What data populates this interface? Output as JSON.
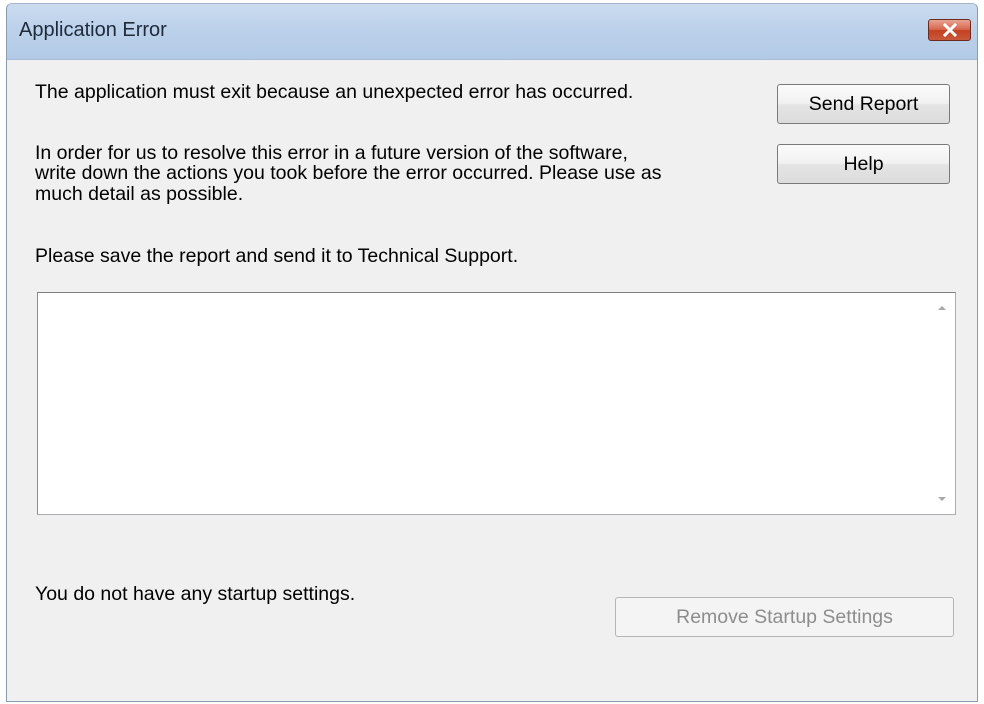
{
  "window": {
    "title": "Application Error",
    "close_icon": "close-x-icon",
    "close_color": "#c7432a"
  },
  "messages": {
    "exit_notice": "The application must exit because an unexpected error has occurred.",
    "resolve_line1": "In order for us to resolve this error in a future version of the software,",
    "resolve_line2": "write down the actions you took before the error occurred. Please use as",
    "resolve_line3": "much detail as possible.",
    "save_report": "Please save the report and send it to Technical Support.",
    "startup_status": "You do not have any startup settings."
  },
  "buttons": {
    "send_report": "Send Report",
    "help": "Help",
    "remove_startup": "Remove Startup Settings"
  },
  "report": {
    "value": "",
    "scroll_up_icon": "scroll-up-arrow-icon",
    "scroll_down_icon": "scroll-down-arrow-icon"
  }
}
